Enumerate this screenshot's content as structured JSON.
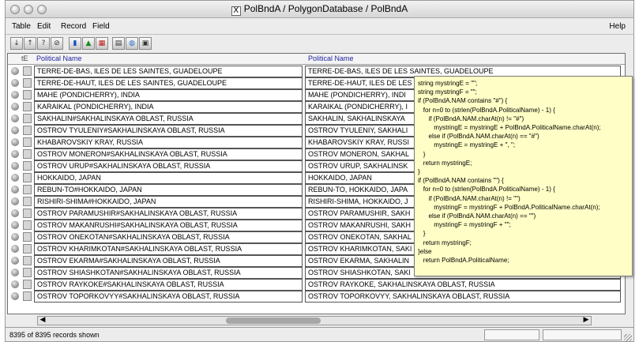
{
  "window": {
    "title": "PolBndA / PolygonDatabase / PolBndA",
    "title_icon": "x11-icon"
  },
  "menubar": {
    "items": [
      "Table",
      "Edit",
      "Record",
      "Field"
    ],
    "help": "Help"
  },
  "toolbar": {
    "icons": [
      "sort-ascending-icon",
      "sort-descending-icon",
      "query-icon",
      "filter-icon",
      "chart-icon",
      "color-chart-icon",
      "table-icon",
      "layout-icon",
      "globe-icon",
      "form-icon"
    ]
  },
  "grid": {
    "headers": [
      "tE",
      "Political Name",
      "Political Name"
    ],
    "rows": [
      [
        "TERRE-DE-BAS, ILES DE LES SAINTES, GUADELOUPE",
        "TERRE-DE-BAS, ILES DE LES SAINTES, GUADELOUPE"
      ],
      [
        "TERRE-DE-HAUT, ILES DE LES SAINTES, GUADELOUPE",
        "TERRE-DE-HAUT, ILES DE LES"
      ],
      [
        "MAHE (PONDICHERRY), INDIA",
        "MAHE (PONDICHERRY), INDI"
      ],
      [
        "KARAIKAL (PONDICHERRY), INDIA",
        "KARAIKAL (PONDICHERRY), I"
      ],
      [
        "SAKHALIN#SAKHALINSKAYA OBLAST, RUSSIA",
        "SAKHALIN, SAKHALINSKAYA"
      ],
      [
        "OSTROV TYULENIY#SAKHALINSKAYA OBLAST, RUSSIA",
        "OSTROV TYULENIY, SAKHALI"
      ],
      [
        "KHABAROVSKIY KRAY, RUSSIA",
        "KHABAROVSKIY KRAY, RUSSI"
      ],
      [
        "OSTROV MONERON#SAKHALINSKAYA OBLAST, RUSSIA",
        "OSTROV MONERON, SAKHAL"
      ],
      [
        "OSTROV URUP#SAKHALINSKAYA OBLAST, RUSSIA",
        "OSTROV URUP, SAKHALINSK"
      ],
      [
        "HOKKAIDO, JAPAN",
        "HOKKAIDO, JAPAN"
      ],
      [
        "REBUN-TO#HOKKAIDO, JAPAN",
        "REBUN-TO, HOKKAIDO, JAPA"
      ],
      [
        "RISHIRI-SHIMA#HOKKAIDO, JAPAN",
        "RISHIRI-SHIMA, HOKKAIDO, J"
      ],
      [
        "OSTROV PARAMUSHIR#SAKHALINSKAYA OBLAST, RUSSIA",
        "OSTROV PARAMUSHIR, SAKH"
      ],
      [
        "OSTROV MAKANRUSHI#SAKHALINSKAYA OBLAST, RUSSIA",
        "OSTROV MAKANRUSHI, SAKH"
      ],
      [
        "OSTROV ONEKOTAN#SAKHALINSKAYA OBLAST, RUSSIA",
        "OSTROV ONEKOTAN, SAKHAL"
      ],
      [
        "OSTROV KHARIMKOTAN#SAKHALINSKAYA OBLAST, RUSSIA",
        "OSTROV KHARIMKOTAN, SAKI"
      ],
      [
        "OSTROV EKARMA#SAKHALINSKAYA OBLAST, RUSSIA",
        "OSTROV EKARMA, SAKHALIN"
      ],
      [
        "OSTROV SHIASHKOTAN#SAKHALINSKAYA OBLAST, RUSSIA",
        "OSTROV SHIASHKOTAN, SAKI"
      ],
      [
        "OSTROV RAYKOKE#SAKHALINSKAYA OBLAST, RUSSIA",
        "OSTROV RAYKOKE, SAKHALINSKAYA OBLAST, RUSSIA"
      ],
      [
        "OSTROV TOPORKOVYY#SAKHALINSKAYA OBLAST, RUSSIA",
        "OSTROV TOPORKOVYY, SAKHALINSKAYA OBLAST, RUSSIA"
      ]
    ]
  },
  "tooltip": {
    "lines": [
      "string mystringE = \"\";",
      "string mystringF = \"\";",
      "",
      "if (PolBndA.NAM contains \"#\") {",
      "   for n=0 to (strlen(PolBndA.PoliticalName) - 1) {",
      "      if (PolBndA.NAM.charAt(n) != \"#\")",
      "         mystringE = mystringE + PolBndA.PoliticalName.charAt(n);",
      "      else if (PolBndA.NAM.charAt(n) == \"#\")",
      "         mystringE = mystringE + \", \";",
      "   }",
      "   return mystringE;",
      "}",
      "if (PolBndA.NAM contains \"\") {",
      "   for n=0 to (strlen(PolBndA.PoliticalName) - 1) {",
      "      if (PolBndA.NAM.charAt(n) != \"\")",
      "         mystringF = mystringF + PolBndA.PoliticalName.charAt(n);",
      "      else if (PolBndA.NAM.charAt(n) == \"\")",
      "         mystringF = mystringF + \"\";",
      "   }",
      "   return mystringF;",
      "}else",
      "   return PolBndA.PoliticalName;"
    ]
  },
  "status": {
    "text": "8395 of 8395 records shown"
  }
}
